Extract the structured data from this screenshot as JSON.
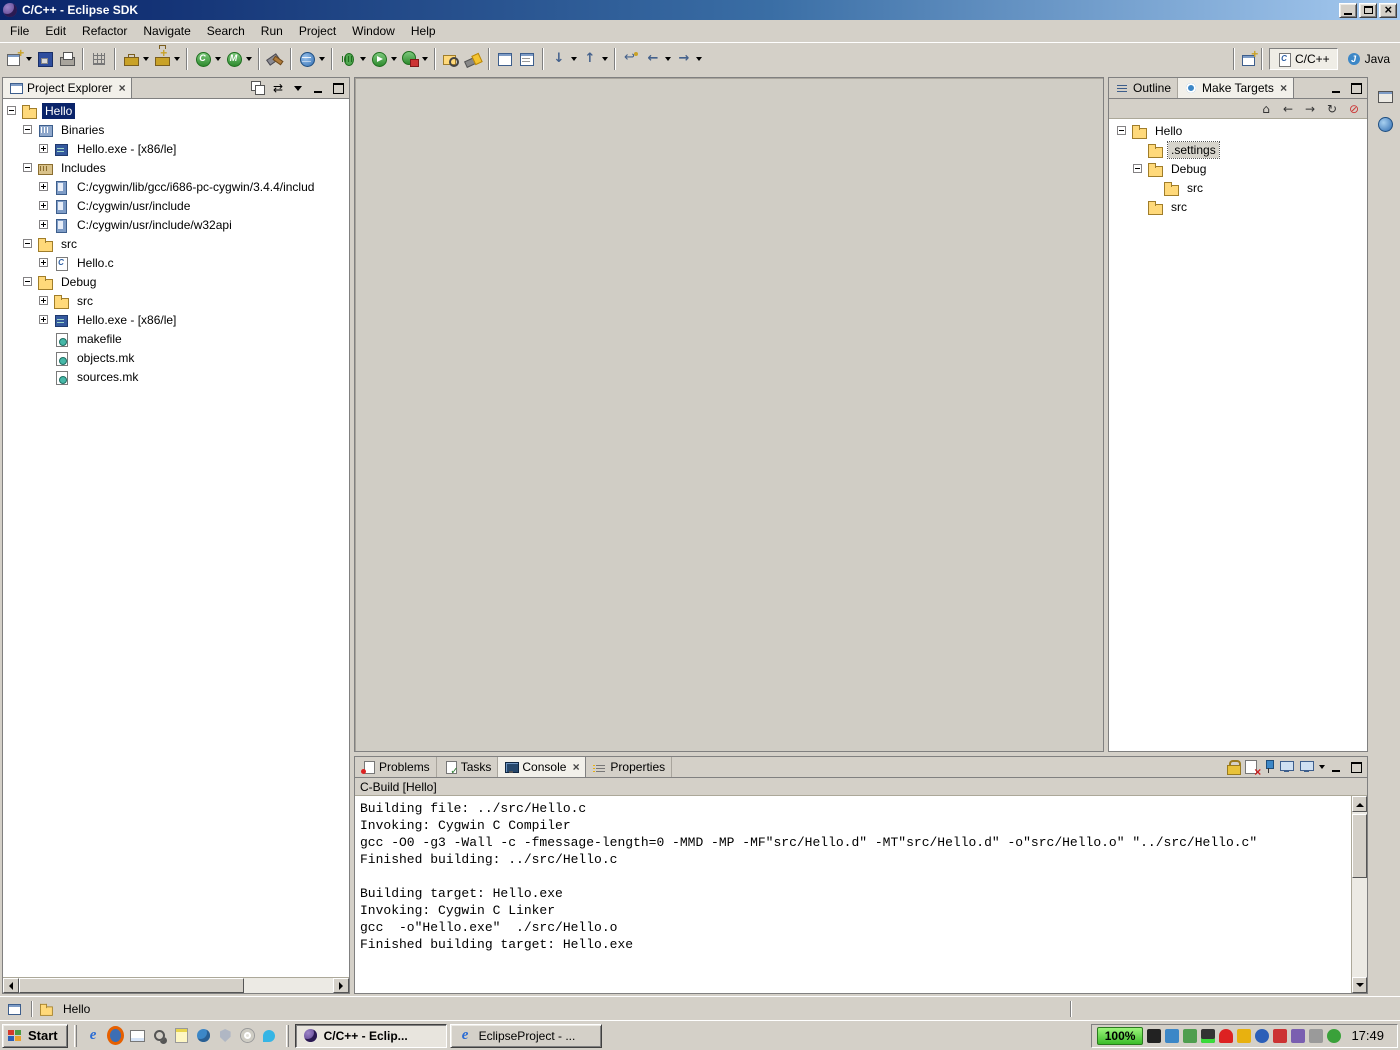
{
  "window": {
    "title": "C/C++ - Eclipse SDK"
  },
  "menu": {
    "items": [
      "File",
      "Edit",
      "Refactor",
      "Navigate",
      "Search",
      "Run",
      "Project",
      "Window",
      "Help"
    ]
  },
  "toolbar": {
    "buttons": [
      "new-wizard",
      "save",
      "print",
      "open-element",
      "new-c-project",
      "new-cpp-project",
      "build-config",
      "make-target",
      "build-all",
      "web-browser",
      "debug",
      "run",
      "external-tools",
      "open-resource",
      "search",
      "toggle-mark-occurrences",
      "show-whitespace",
      "next-annotation",
      "previous-annotation",
      "last-edit-location",
      "back",
      "forward"
    ]
  },
  "perspective_bar": {
    "tabs": [
      {
        "label": "C/C++",
        "active": true
      },
      {
        "label": "Java",
        "active": false
      }
    ]
  },
  "project_explorer": {
    "title": "Project Explorer",
    "tree": [
      {
        "depth": 0,
        "expander": "minus",
        "icon": "project",
        "label": "Hello",
        "selected": true
      },
      {
        "depth": 1,
        "expander": "minus",
        "icon": "binaries",
        "label": "Binaries",
        "selected": false
      },
      {
        "depth": 2,
        "expander": "plus",
        "icon": "executable",
        "label": "Hello.exe - [x86/le]",
        "selected": false
      },
      {
        "depth": 1,
        "expander": "minus",
        "icon": "includes",
        "label": "Includes",
        "selected": false
      },
      {
        "depth": 2,
        "expander": "plus",
        "icon": "include-path",
        "label": "C:/cygwin/lib/gcc/i686-pc-cygwin/3.4.4/includ",
        "selected": false
      },
      {
        "depth": 2,
        "expander": "plus",
        "icon": "include-path",
        "label": "C:/cygwin/usr/include",
        "selected": false
      },
      {
        "depth": 2,
        "expander": "plus",
        "icon": "include-path",
        "label": "C:/cygwin/usr/include/w32api",
        "selected": false
      },
      {
        "depth": 1,
        "expander": "minus",
        "icon": "source-folder",
        "label": "src",
        "selected": false
      },
      {
        "depth": 2,
        "expander": "plus",
        "icon": "c-file",
        "label": "Hello.c",
        "selected": false
      },
      {
        "depth": 1,
        "expander": "minus",
        "icon": "folder",
        "label": "Debug",
        "selected": false
      },
      {
        "depth": 2,
        "expander": "plus",
        "icon": "folder",
        "label": "src",
        "selected": false
      },
      {
        "depth": 2,
        "expander": "plus",
        "icon": "executable",
        "label": "Hello.exe - [x86/le]",
        "selected": false
      },
      {
        "depth": 2,
        "expander": "none",
        "icon": "makefile",
        "label": "makefile",
        "selected": false
      },
      {
        "depth": 2,
        "expander": "none",
        "icon": "makefile",
        "label": "objects.mk",
        "selected": false
      },
      {
        "depth": 2,
        "expander": "none",
        "icon": "makefile",
        "label": "sources.mk",
        "selected": false
      }
    ]
  },
  "right_panel": {
    "tabs": [
      {
        "label": "Outline",
        "active": false
      },
      {
        "label": "Make Targets",
        "active": true
      }
    ],
    "tree": [
      {
        "depth": 0,
        "expander": "minus",
        "icon": "project",
        "label": "Hello",
        "selected": false
      },
      {
        "depth": 1,
        "expander": "none",
        "icon": "folder",
        "label": ".settings",
        "selected": true
      },
      {
        "depth": 1,
        "expander": "minus",
        "icon": "folder",
        "label": "Debug",
        "selected": false
      },
      {
        "depth": 2,
        "expander": "none",
        "icon": "folder",
        "label": "src",
        "selected": false
      },
      {
        "depth": 1,
        "expander": "none",
        "icon": "folder",
        "label": "src",
        "selected": false
      }
    ]
  },
  "bottom_panel": {
    "tabs": [
      {
        "label": "Problems",
        "active": false
      },
      {
        "label": "Tasks",
        "active": false
      },
      {
        "label": "Console",
        "active": true
      },
      {
        "label": "Properties",
        "active": false
      }
    ],
    "console": {
      "title": "C-Build [Hello]",
      "lines": [
        "Building file: ../src/Hello.c",
        "Invoking: Cygwin C Compiler",
        "gcc -O0 -g3 -Wall -c -fmessage-length=0 -MMD -MP -MF\"src/Hello.d\" -MT\"src/Hello.d\" -o\"src/Hello.o\" \"../src/Hello.c\"",
        "Finished building: ../src/Hello.c",
        "",
        "Building target: Hello.exe",
        "Invoking: Cygwin C Linker",
        "gcc  -o\"Hello.exe\"  ./src/Hello.o",
        "Finished building target: Hello.exe"
      ]
    }
  },
  "status_bar": {
    "selection": "Hello"
  },
  "taskbar": {
    "start_label": "Start",
    "tasks": [
      {
        "label": "C/C++ - Eclip...",
        "active": true
      },
      {
        "label": "EclipseProject - ...",
        "active": false
      }
    ],
    "tray": {
      "meter": "100%",
      "clock": "17:49"
    }
  },
  "icons": {
    "close": "×",
    "minimize": "bar",
    "maximize": "square",
    "expander-expanded": "-",
    "expander-collapsed": "+",
    "view-menu": "▼",
    "link-with-editor": "⇄",
    "home": "⌂",
    "back-arrow": "←",
    "forward-arrow": "→",
    "refresh": "↻",
    "dropdown": "▼"
  },
  "colors": {
    "titlebar_left": "#0A246A",
    "titlebar_right": "#A6CAF0",
    "chrome": "#D4D0C8",
    "selection": "#0A246A",
    "meter_green": "#3DBE2B"
  }
}
